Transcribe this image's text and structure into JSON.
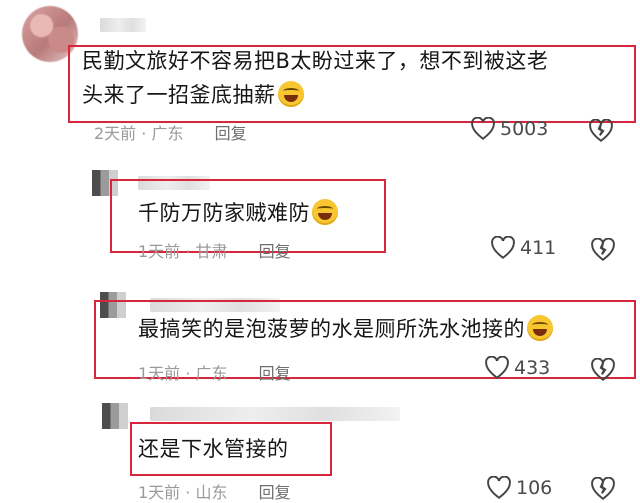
{
  "comments": [
    {
      "text_line1": "民勤文旅好不容易把B太盼过来了，想不到被这老",
      "text_line2": "头来了一招釜底抽薪",
      "time": "2天前",
      "location": "广东",
      "reply_label": "回复",
      "likes": "5003"
    },
    {
      "text": "千防万防家贼难防",
      "time": "1天前",
      "location": "甘肃",
      "reply_label": "回复",
      "likes": "411"
    },
    {
      "text": "最搞笑的是泡菠萝的水是厕所洗水池接的",
      "time": "1天前",
      "location": "广东",
      "reply_label": "回复",
      "likes": "433"
    },
    {
      "text": "还是下水管接的",
      "time": "1天前",
      "location": "山东",
      "reply_label": "回复",
      "likes": "106"
    }
  ],
  "colors": {
    "highlight_border": "#d7263d",
    "meta_text": "#9a9a9a"
  },
  "icons": {
    "like": "heart-icon",
    "dislike": "broken-heart-icon",
    "emoji": "laughing-tears-emoji"
  }
}
